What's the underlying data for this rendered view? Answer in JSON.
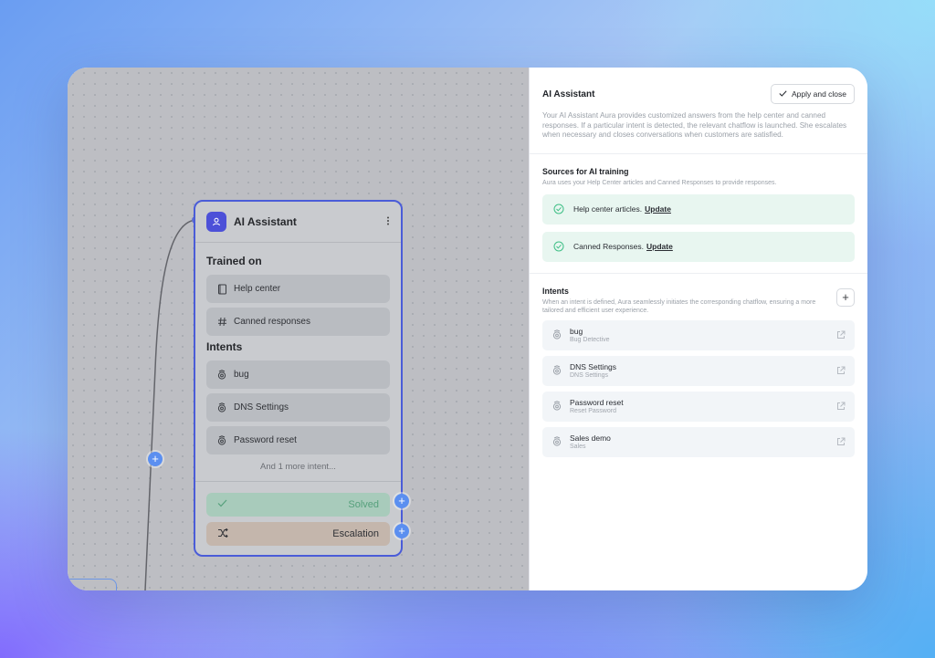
{
  "node": {
    "title": "AI Assistant",
    "menu_icon": "more-vertical-icon",
    "trained_on_label": "Trained on",
    "trained_on": [
      {
        "label": "Help center",
        "icon": "book-icon"
      },
      {
        "label": "Canned responses",
        "icon": "hash-icon"
      }
    ],
    "intents_label": "Intents",
    "intents": [
      {
        "label": "bug",
        "icon": "intent-icon"
      },
      {
        "label": "DNS Settings",
        "icon": "intent-icon"
      },
      {
        "label": "Password reset",
        "icon": "intent-icon"
      }
    ],
    "more_text": "And 1 more intent...",
    "outputs": {
      "solved": "Solved",
      "escalation": "Escalation"
    },
    "plus": "+"
  },
  "panel": {
    "title": "AI Assistant",
    "apply_label": "Apply and close",
    "description": "Your AI Assistant Aura provides customized answers from the help center and canned responses. If a particular intent is detected, the relevant chatflow is launched. She escalates when necessary and closes conversations when customers are satisfied.",
    "sources": {
      "title": "Sources for AI training",
      "subtitle": "Aura uses your Help Center articles and Canned Responses to provide responses.",
      "items": [
        {
          "label": "Help center articles.",
          "link": "Update"
        },
        {
          "label": "Canned Responses.",
          "link": "Update"
        }
      ]
    },
    "intents": {
      "title": "Intents",
      "subtitle": "When an intent is defined, Aura seamlessly initiates the corresponding chatflow, ensuring a more tailored and efficient user experience.",
      "add": "+",
      "items": [
        {
          "name": "bug",
          "flow": "Bug Detective"
        },
        {
          "name": "DNS Settings",
          "flow": "DNS Settings"
        },
        {
          "name": "Password reset",
          "flow": "Reset Password"
        },
        {
          "name": "Sales demo",
          "flow": "Sales"
        }
      ]
    }
  },
  "colors": {
    "accent": "#4c50d8",
    "connector": "#5b8ff0",
    "success_bg": "#e8f6f0",
    "success": "#3fbf86"
  }
}
